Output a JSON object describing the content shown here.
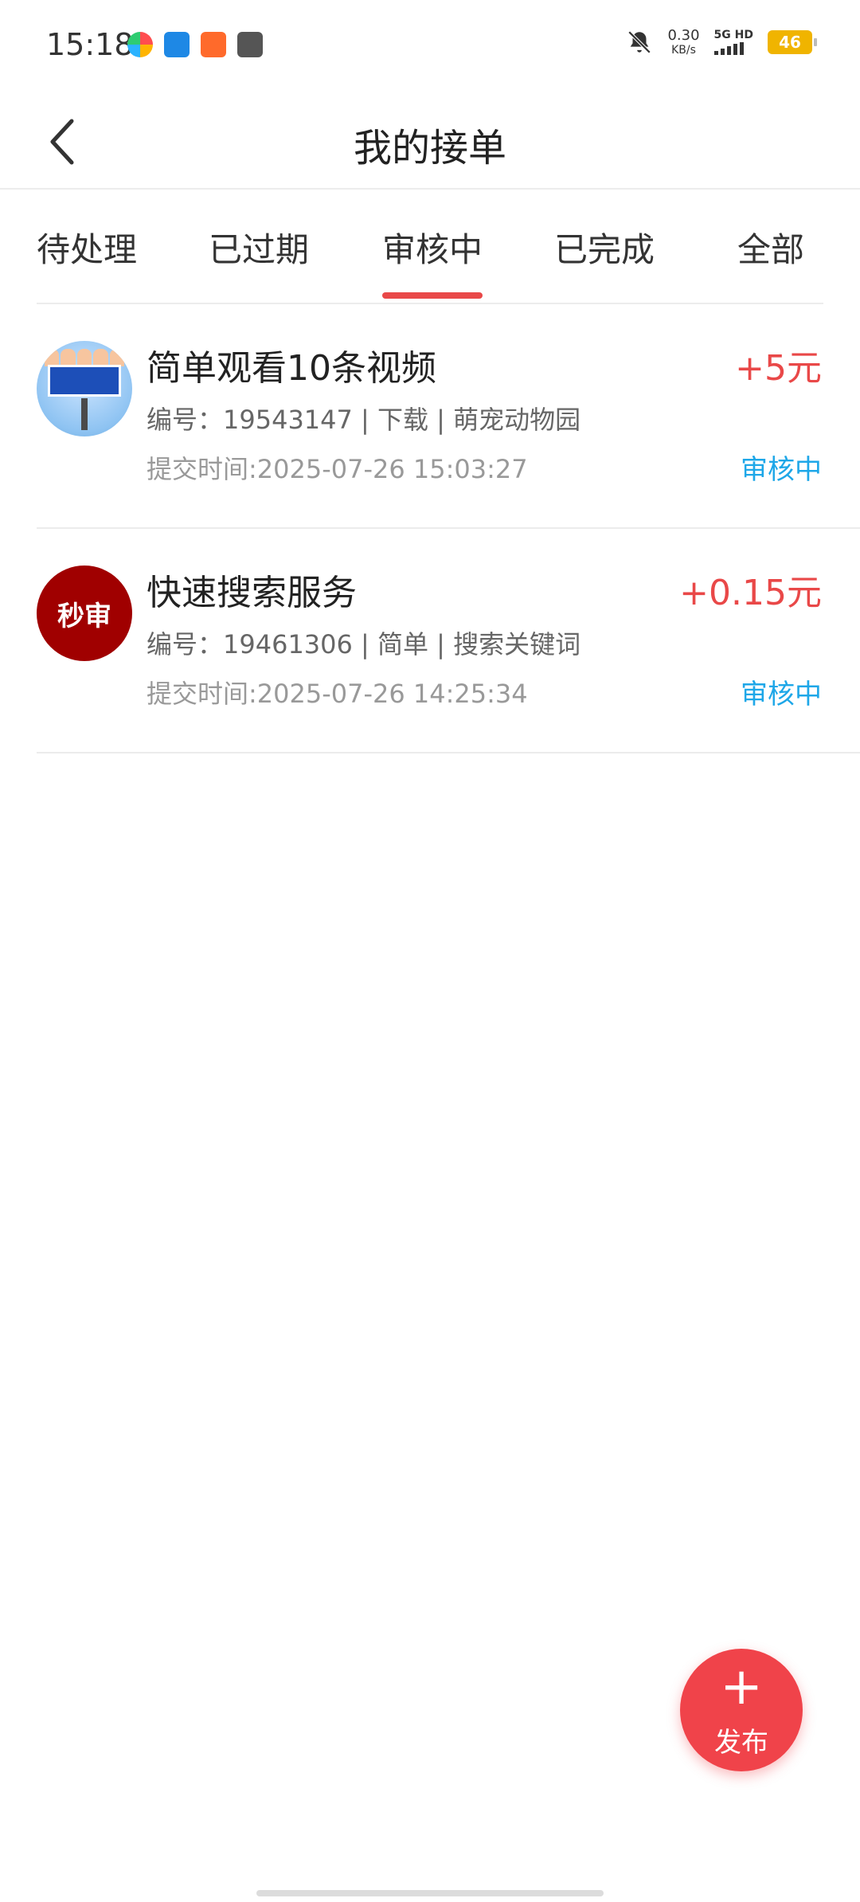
{
  "status_bar": {
    "time": "15:18",
    "app_icons": [
      "browser-app-icon",
      "e-app-icon",
      "shop-app-icon",
      "inbox-app-icon"
    ],
    "net_speed_value": "0.30",
    "net_speed_unit": "KB/s",
    "network_label": "5G HD",
    "battery": "46"
  },
  "header": {
    "title": "我的接单"
  },
  "tabs": [
    {
      "label": "待处理",
      "active": false
    },
    {
      "label": "已过期",
      "active": false
    },
    {
      "label": "审核中",
      "active": true
    },
    {
      "label": "已完成",
      "active": false
    },
    {
      "label": "全部",
      "active": false
    }
  ],
  "orders": [
    {
      "title": "简单观看10条视频",
      "amount": "+5元",
      "meta": "编号：19543147 | 下载 | 萌宠动物园",
      "submit_time": "提交时间:2025-07-26 15:03:27",
      "status": "审核中"
    },
    {
      "title": "快速搜索服务",
      "avatar_text": "秒审",
      "amount": "+0.15元",
      "meta": "编号：19461306 | 简单 | 搜索关键词",
      "submit_time": "提交时间:2025-07-26 14:25:34",
      "status": "审核中"
    }
  ],
  "fab": {
    "plus": "+",
    "label": "发布"
  },
  "colors": {
    "accent_red": "#e94848",
    "status_blue": "#1ea7e8",
    "fab_red": "#f0434a"
  }
}
